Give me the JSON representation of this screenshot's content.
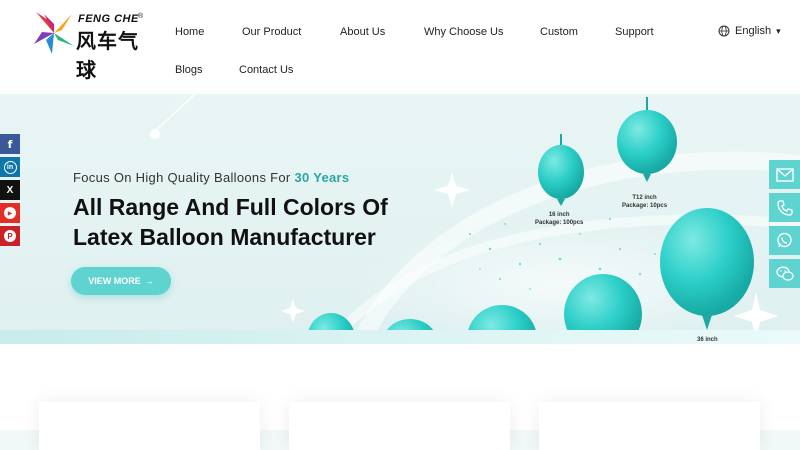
{
  "brand": {
    "name_en": "FENG CHE",
    "name_cn": "风车气球",
    "reg_mark": "®"
  },
  "nav": {
    "items": [
      "Home",
      "Our Product",
      "About Us",
      "Why Choose Us",
      "Custom",
      "Support",
      "Blogs",
      "Contact Us"
    ]
  },
  "language": {
    "label": "English",
    "icon": "globe-icon",
    "caret": "▾"
  },
  "hero": {
    "subtitle_prefix": "Focus On High Quality Balloons For ",
    "subtitle_highlight": "30 Years",
    "headline": "All Range And Full Colors Of Latex Balloon Manufacturer",
    "cta_label": "VIEW MORE",
    "cta_arrow": "→",
    "balloon_labels": {
      "b16_size": "16 inch",
      "b16_pkg": "Package: 100pcs",
      "t12_size": "T12 inch",
      "t12_pkg": "Package: 10pcs",
      "b36_size": "36 inch"
    }
  },
  "social": [
    {
      "icon": "facebook-icon",
      "glyph": "f",
      "color": "#3b5998"
    },
    {
      "icon": "linkedin-icon",
      "glyph": "in",
      "color": "#0e76a8"
    },
    {
      "icon": "x-icon",
      "glyph": "X",
      "color": "#111111"
    },
    {
      "icon": "youtube-icon",
      "glyph": "▶",
      "color": "#e52d27"
    },
    {
      "icon": "pinterest-icon",
      "glyph": "P",
      "color": "#cb2027"
    }
  ],
  "contact": [
    {
      "icon": "email-icon"
    },
    {
      "icon": "phone-icon"
    },
    {
      "icon": "whatsapp-icon"
    },
    {
      "icon": "wechat-icon"
    }
  ],
  "colors": {
    "accent": "#5fd3cf",
    "highlight": "#2aa7a3",
    "balloon": "#28cfc9"
  }
}
